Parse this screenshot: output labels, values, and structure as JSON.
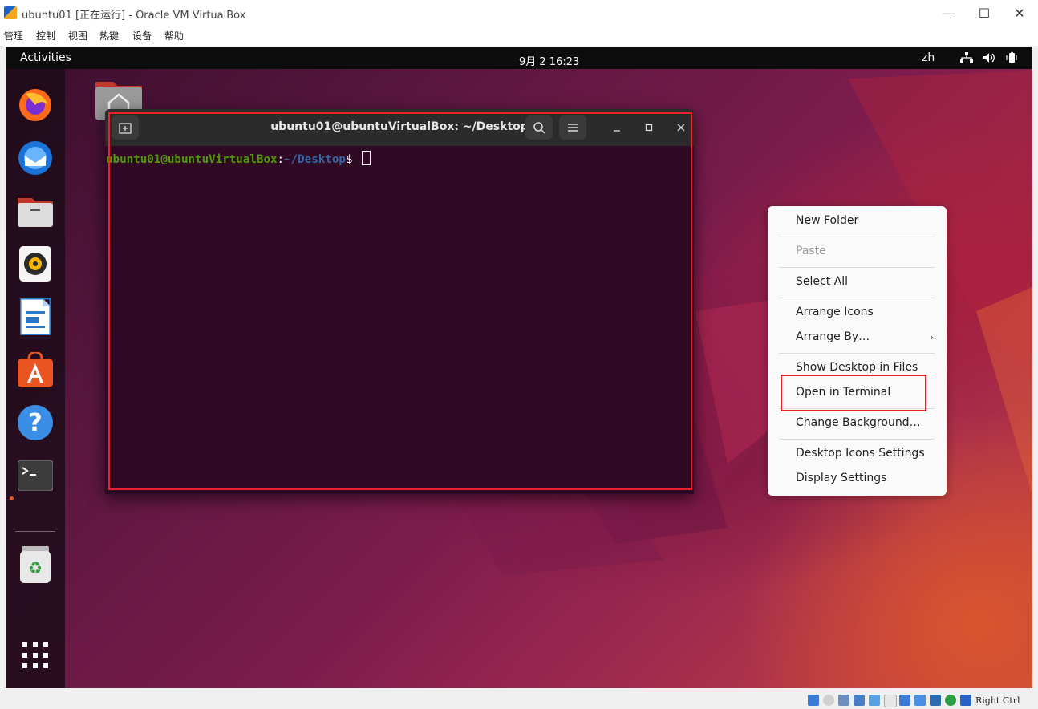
{
  "host": {
    "title": "ubuntu01 [正在运行] - Oracle VM VirtualBox",
    "minimize": "—",
    "maximize": "☐",
    "close": "✕",
    "menu": [
      "管理",
      "控制",
      "视图",
      "热键",
      "设备",
      "帮助"
    ],
    "host_key": "Right Ctrl"
  },
  "topbar": {
    "activities": "Activities",
    "clock": "9月 2  16:23",
    "lang": "zh"
  },
  "dock": {
    "items": [
      "firefox-icon",
      "thunderbird-icon",
      "files-icon",
      "rhythmbox-icon",
      "libreoffice-writer-icon",
      "app-center-icon",
      "help-icon",
      "terminal-icon",
      "trash-icon",
      "show-apps-icon"
    ]
  },
  "terminal": {
    "title": "ubuntu01@ubuntuVirtualBox: ~/Desktop",
    "prompt_user": "ubuntu01@ubuntuVirtualBox",
    "prompt_colon": ":",
    "prompt_path": "~/Desktop",
    "prompt_symbol": "$ "
  },
  "context_menu": {
    "new_folder": "New Folder",
    "paste": "Paste",
    "select_all": "Select All",
    "arrange_icons": "Arrange Icons",
    "arrange_by": "Arrange By…",
    "show_desktop": "Show Desktop in Files",
    "open_terminal": "Open in Terminal",
    "change_background": "Change Background…",
    "icons_settings": "Desktop Icons Settings",
    "display_settings": "Display Settings"
  },
  "colors": {
    "annotation": "#e8222a",
    "terminal_bg": "#300a24",
    "accent": "#e95420"
  }
}
